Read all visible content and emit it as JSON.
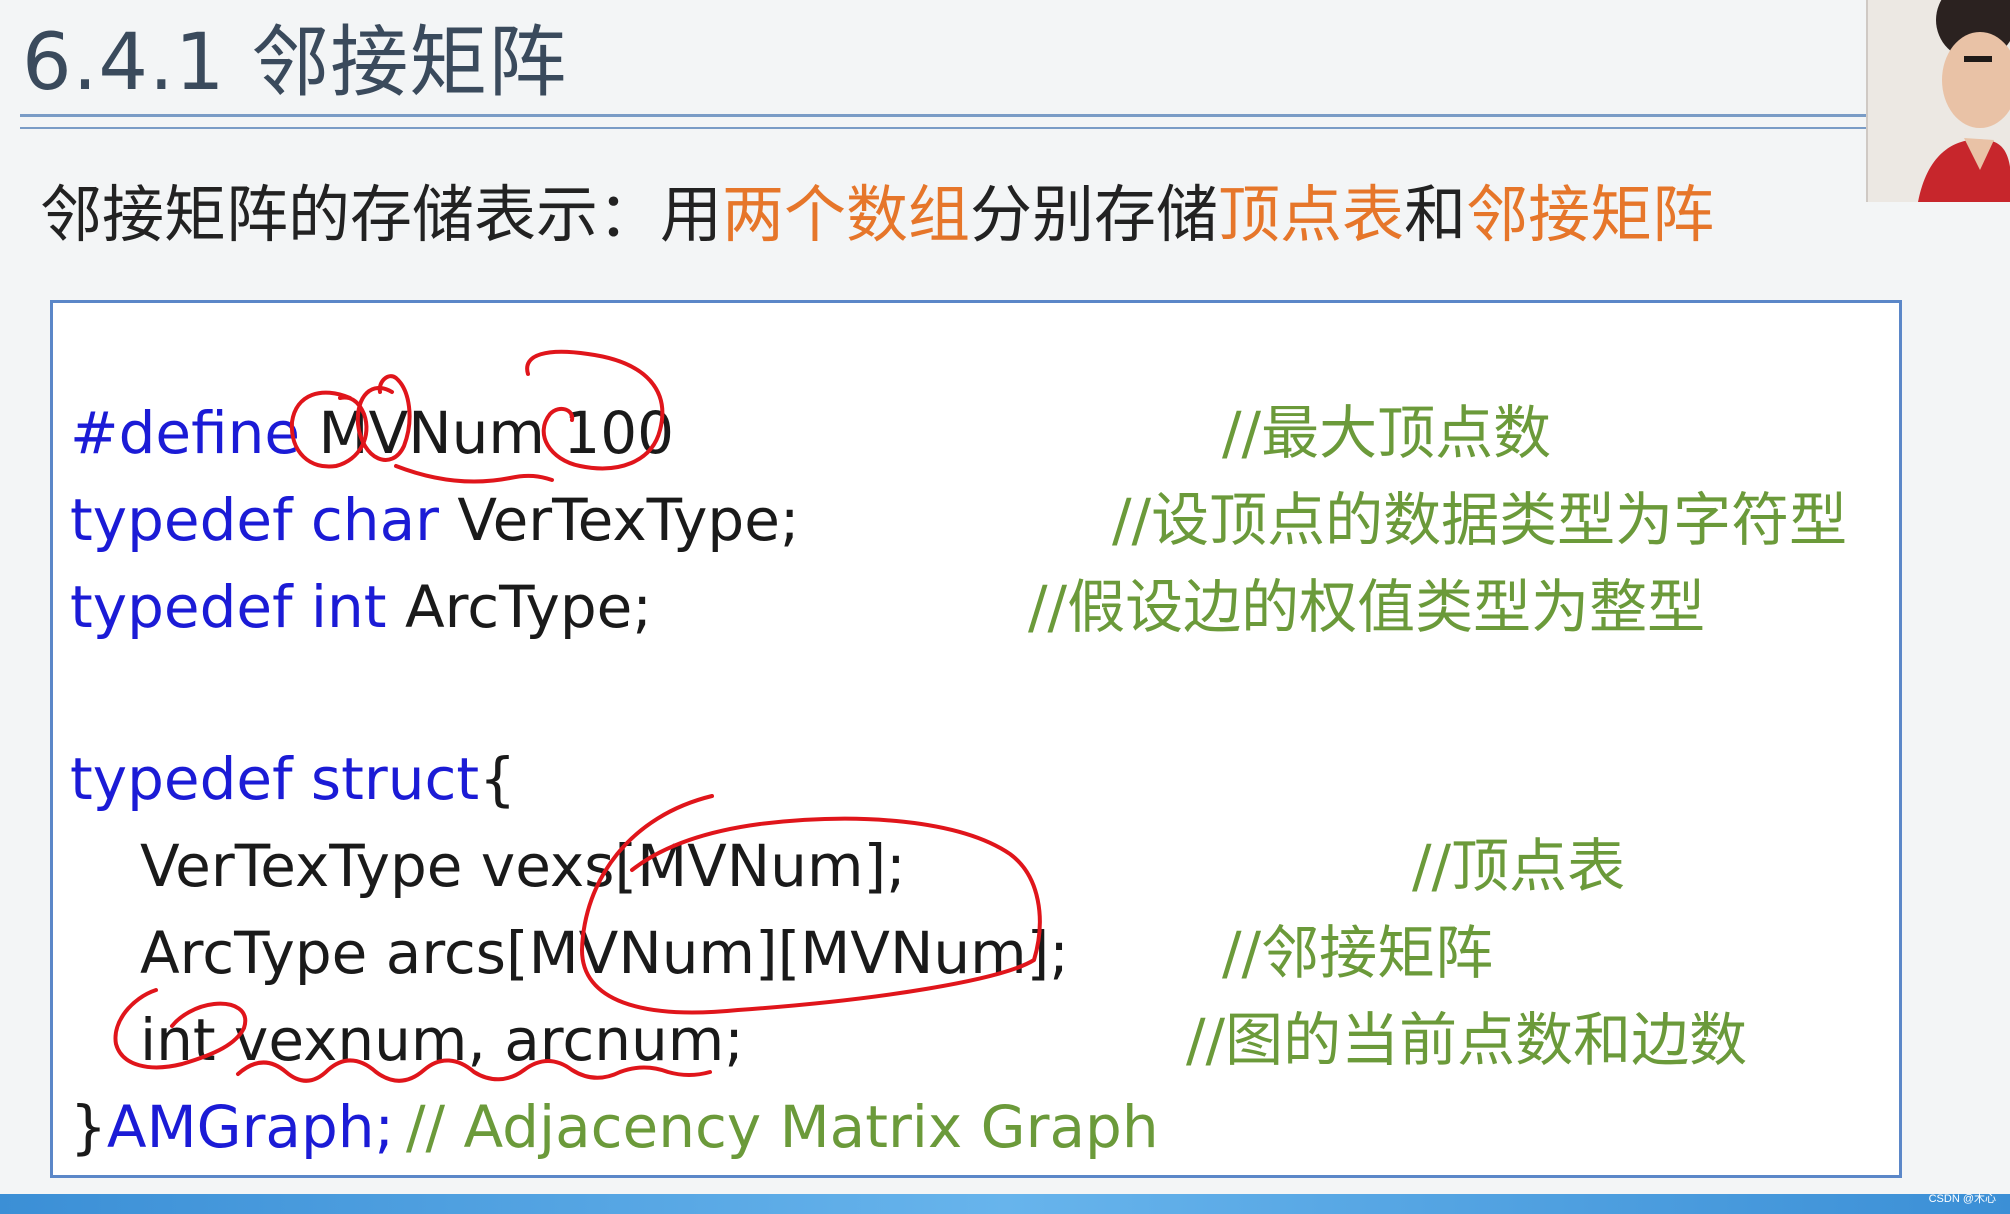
{
  "slide": {
    "title": "6.4.1 邻接矩阵",
    "subtitle_parts": [
      "邻接矩阵的存储表示：用",
      "两个数组",
      "分别存储",
      "顶点表",
      "和",
      "邻接矩阵"
    ]
  },
  "code": {
    "line1": {
      "kw": "#define",
      "text": " MVNum 100",
      "comment": "//最大顶点数"
    },
    "line2": {
      "kw": "typedef char",
      "text": " VerTexType;",
      "comment": "//设顶点的数据类型为字符型"
    },
    "line3": {
      "kw": "typedef int",
      "text": " ArcType;",
      "comment": "//假设边的权值类型为整型"
    },
    "line4": {
      "kw": "typedef struct",
      "text": "{"
    },
    "line5": {
      "text": "VerTexType vexs[MVNum];",
      "comment": "//顶点表"
    },
    "line6": {
      "text": "ArcType arcs[MVNum][MVNum];",
      "comment": "//邻接矩阵"
    },
    "line7": {
      "text": "int vexnum, arcnum;",
      "comment": "//图的当前点数和边数"
    },
    "line8": {
      "brace": "}",
      "kw": "AMGraph;",
      "comment": "// Adjacency Matrix Graph"
    }
  },
  "footer": {
    "watermark": "CSDN @木心"
  },
  "colors": {
    "keyword": "#1b1bd6",
    "comment": "#6b9a3a",
    "highlight": "#e6762a",
    "annotation": "#e0151b"
  }
}
